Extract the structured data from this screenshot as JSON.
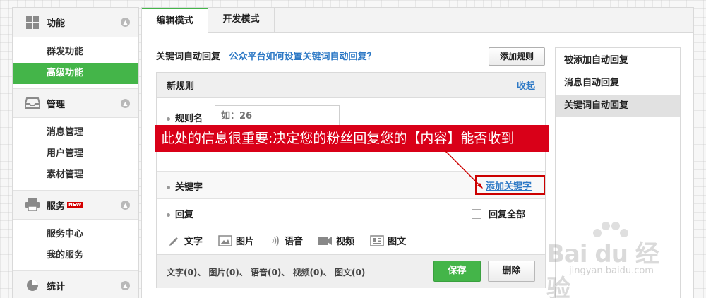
{
  "sidebar": {
    "sections": [
      {
        "title": "功能",
        "items": [
          "群发功能",
          "高级功能"
        ],
        "active_item": "高级功能"
      },
      {
        "title": "管理",
        "items": [
          "消息管理",
          "用户管理",
          "素材管理"
        ]
      },
      {
        "title": "服务",
        "badge": "NEW",
        "items": [
          "服务中心",
          "我的服务"
        ]
      },
      {
        "title": "统计"
      }
    ]
  },
  "tabs": [
    "编辑模式",
    "开发模式"
  ],
  "active_tab": "编辑模式",
  "header": {
    "title": "关键词自动回复",
    "help_link": "公众平台如何设置关键词自动回复？",
    "add_rule_button": "添加规则"
  },
  "rule_panel": {
    "title": "新规则",
    "collapse": "收起",
    "rule_name_label": "规则名",
    "rule_name_placeholder": "如：26",
    "keyword_label": "关键字",
    "add_keyword": "添加关键字",
    "reply_label": "回复",
    "reply_all_label": "回复全部",
    "tools": [
      "文字",
      "图片",
      "语音",
      "视频",
      "图文"
    ],
    "summary": "文字(0)、 图片(0)、 语音(0)、 视频(0)、 图文(0)",
    "save_button": "保存",
    "delete_button": "删除"
  },
  "right_menu": {
    "items": [
      "被添加自动回复",
      "消息自动回复",
      "关键词自动回复"
    ],
    "active_item": "关键词自动回复"
  },
  "annotation": {
    "text": "此处的信息很重要:决定您的粉丝回复您的【内容】能否收到",
    "color": "#d90018"
  },
  "watermark": {
    "logo": "Bai du 经验",
    "url": "jingyan.baidu.com"
  },
  "colors": {
    "accent": "#44b549",
    "link": "#2c78c5"
  }
}
